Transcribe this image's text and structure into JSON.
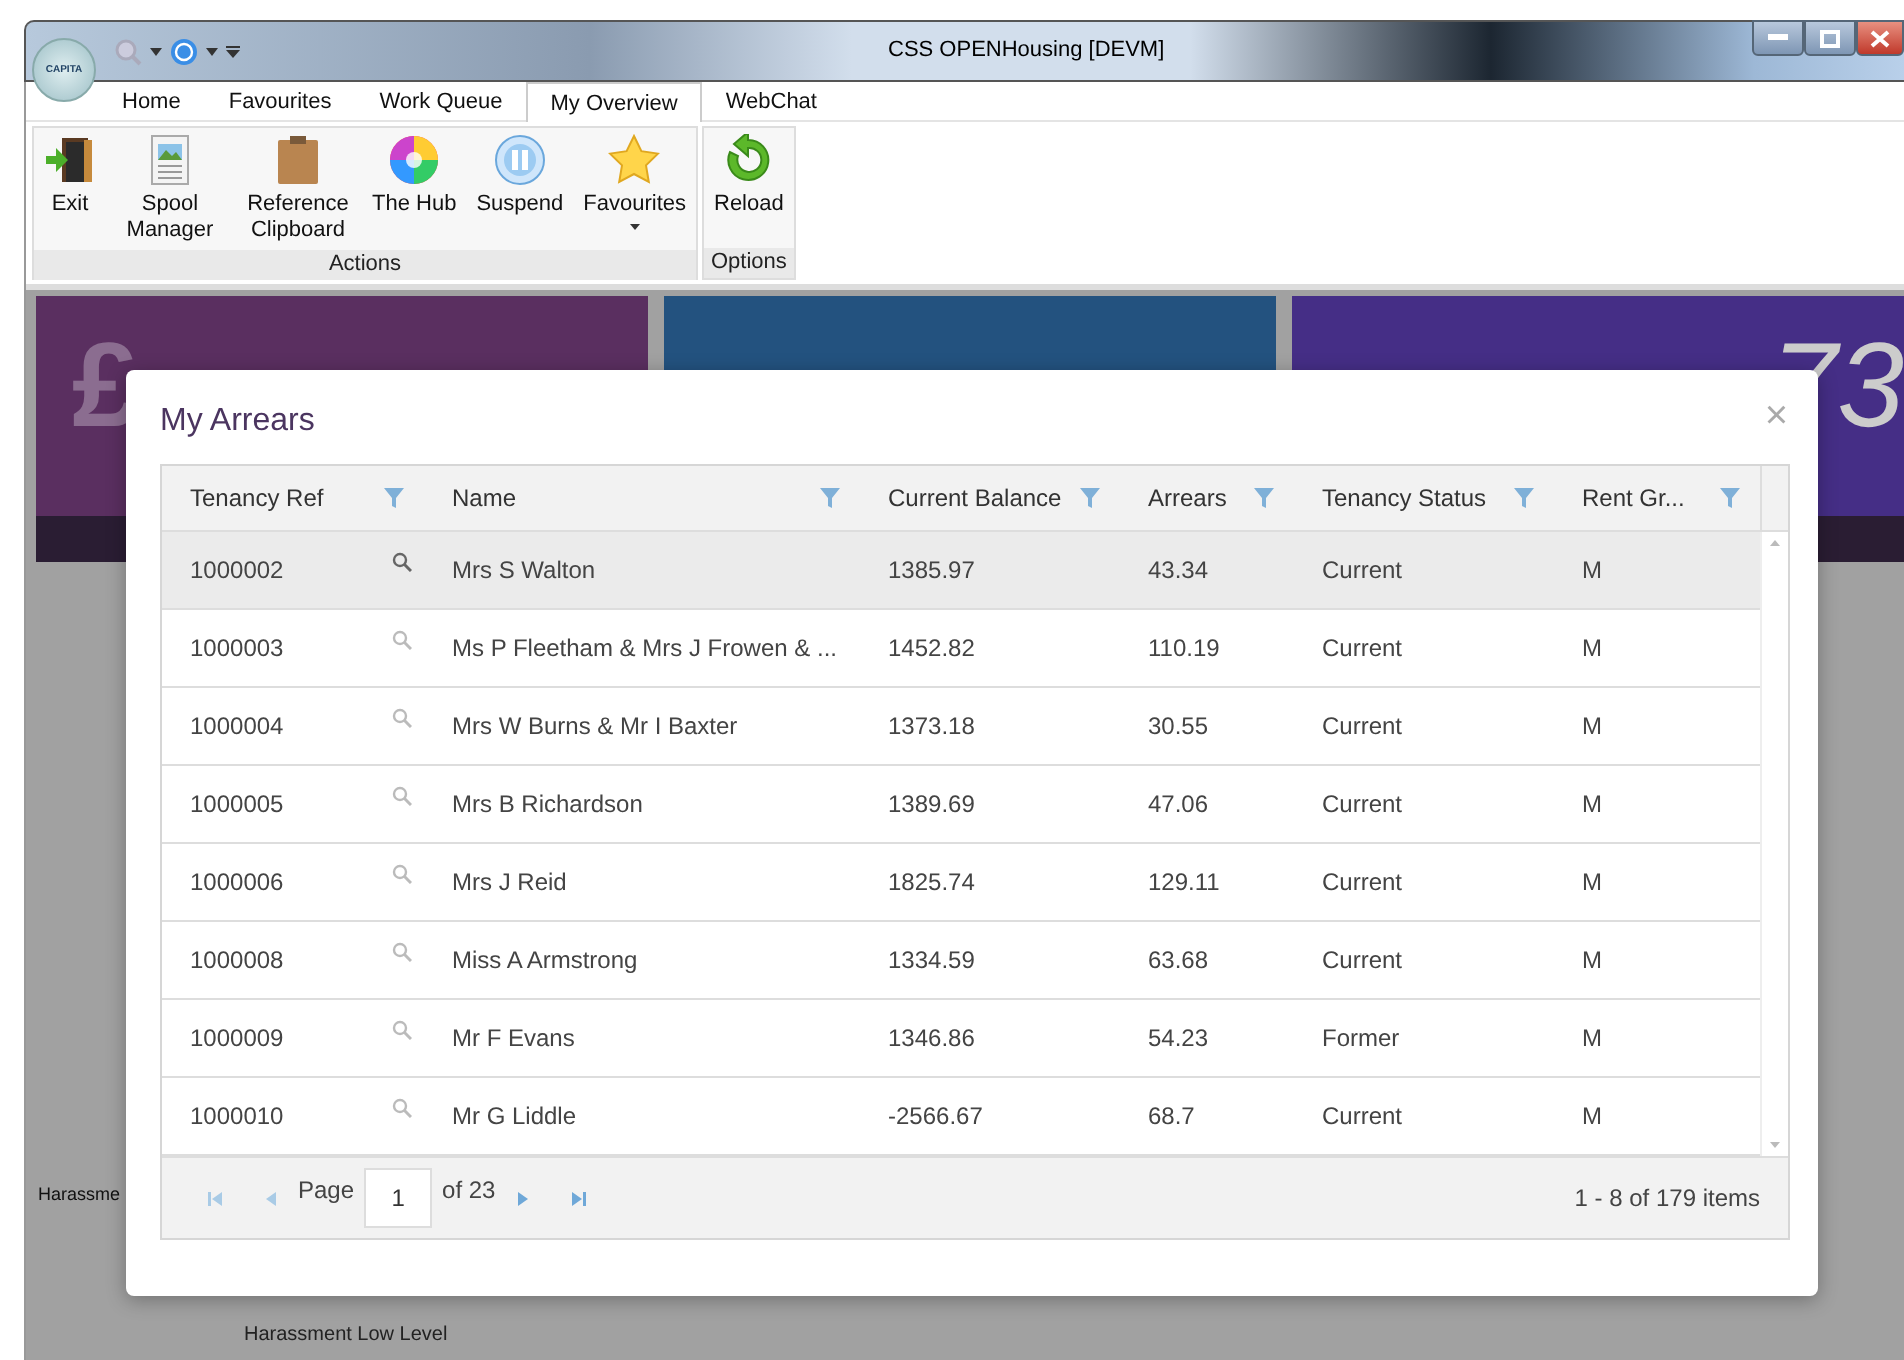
{
  "window": {
    "title": "CSS OPENHousing [DEVM]",
    "logo": "CAPITA"
  },
  "tabs": [
    {
      "label": "Home",
      "selected": false
    },
    {
      "label": "Favourites",
      "selected": false
    },
    {
      "label": "Work Queue",
      "selected": false
    },
    {
      "label": "My Overview",
      "selected": true
    },
    {
      "label": "WebChat",
      "selected": false
    }
  ],
  "ribbon": [
    {
      "label": "Actions",
      "buttons": [
        {
          "label": "Exit"
        },
        {
          "label": "Spool Manager"
        },
        {
          "label": "Reference Clipboard"
        },
        {
          "label": "The Hub"
        },
        {
          "label": "Suspend"
        },
        {
          "label": "Favourites",
          "dropdown": true
        }
      ]
    },
    {
      "label": "Options",
      "buttons": [
        {
          "label": "Reload"
        }
      ]
    }
  ],
  "background": {
    "tiles": [
      {
        "glyph": "£",
        "color": "#5a2f60"
      },
      {
        "color": "#23527f"
      },
      {
        "glyph": "73",
        "color": "#452e86"
      }
    ],
    "left_label": "Harassme",
    "bottom_label": "Harassment Low Level"
  },
  "dialog": {
    "title": "My Arrears",
    "close": "×",
    "columns": [
      {
        "label": "Tenancy Ref"
      },
      {
        "label": "Name"
      },
      {
        "label": "Current Balance"
      },
      {
        "label": "Arrears"
      },
      {
        "label": "Tenancy Status"
      },
      {
        "label": "Rent Gr..."
      }
    ],
    "rows": [
      {
        "cells": [
          "1000002",
          "Mrs S Walton",
          "1385.97",
          "43.34",
          "Current",
          "M"
        ],
        "selected": true
      },
      {
        "cells": [
          "1000003",
          "Ms P Fleetham & Mrs J Frowen & ...",
          "1452.82",
          "110.19",
          "Current",
          "M"
        ],
        "selected": false
      },
      {
        "cells": [
          "1000004",
          "Mrs W Burns & Mr I Baxter",
          "1373.18",
          "30.55",
          "Current",
          "M"
        ],
        "selected": false
      },
      {
        "cells": [
          "1000005",
          "Mrs B Richardson",
          "1389.69",
          "47.06",
          "Current",
          "M"
        ],
        "selected": false
      },
      {
        "cells": [
          "1000006",
          "Mrs J Reid",
          "1825.74",
          "129.11",
          "Current",
          "M"
        ],
        "selected": false
      },
      {
        "cells": [
          "1000008",
          "Miss A Armstrong",
          "1334.59",
          "63.68",
          "Current",
          "M"
        ],
        "selected": false
      },
      {
        "cells": [
          "1000009",
          "Mr F Evans",
          "1346.86",
          "54.23",
          "Former",
          "M"
        ],
        "selected": false
      },
      {
        "cells": [
          "1000010",
          "Mr G Liddle",
          "-2566.67",
          "68.7",
          "Current",
          "M"
        ],
        "selected": false
      }
    ],
    "pager": {
      "page_label": "Page",
      "page": "1",
      "of_label": "of 23",
      "summary": "1 - 8 of 179 items"
    }
  }
}
